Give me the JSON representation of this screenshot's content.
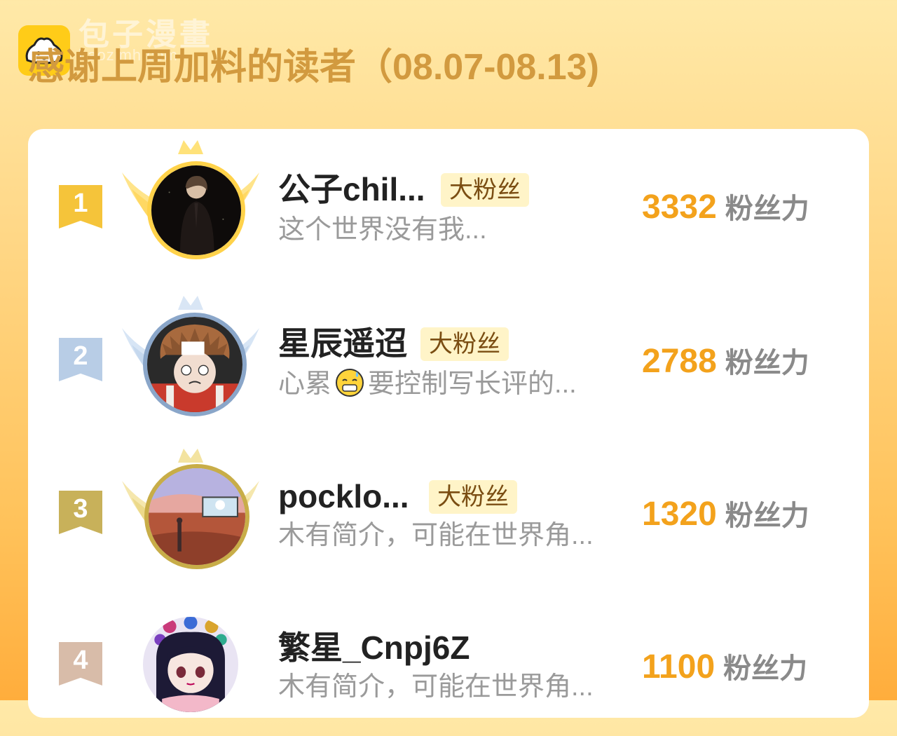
{
  "watermark": {
    "title": "包子漫畫",
    "url": "baozimh.com"
  },
  "page": {
    "title": "感谢上周加料的读者（08.07-08.13)"
  },
  "colors": {
    "gold": "#f3a21c",
    "silver": "#b8cde6",
    "bronze": "#c8b15a",
    "fourth": "#d8bca9",
    "title": "#d29a3f",
    "tag_bg": "#fff4c8"
  },
  "leaderboard": [
    {
      "rank": "1",
      "name": "公子chil...",
      "tag": "大粉丝",
      "bio": "这个世界没有我...",
      "bio_after_emoji": "",
      "score": "3332",
      "unit": "粉丝力"
    },
    {
      "rank": "2",
      "name": "星辰遥迢",
      "tag": "大粉丝",
      "bio": "心累",
      "bio_after_emoji": "要控制写长评的...",
      "score": "2788",
      "unit": "粉丝力"
    },
    {
      "rank": "3",
      "name": "pocklo...",
      "tag": "大粉丝",
      "bio": "木有简介，可能在世界角...",
      "bio_after_emoji": "",
      "score": "1320",
      "unit": "粉丝力"
    },
    {
      "rank": "4",
      "name": "繁星_Cnpj6Z",
      "tag": "",
      "bio": "木有简介，可能在世界角...",
      "bio_after_emoji": "",
      "score": "1100",
      "unit": "粉丝力"
    }
  ]
}
